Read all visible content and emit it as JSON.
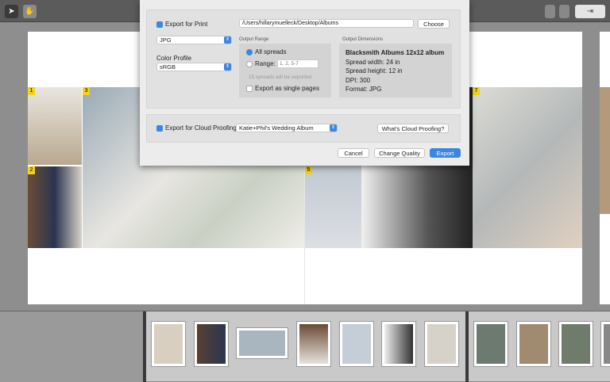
{
  "toolbar": {
    "tools": [
      {
        "icon": "arrow-pointer-icon",
        "glyph": "➤"
      },
      {
        "icon": "hand-icon",
        "glyph": "✋"
      }
    ],
    "right": [
      {
        "icon": "single-page-view-icon"
      },
      {
        "icon": "spread-view-icon"
      },
      {
        "icon": "export-icon",
        "glyph": "⇥"
      }
    ]
  },
  "spread": {
    "pages": [
      "1",
      "2",
      "3",
      "5",
      "7"
    ]
  },
  "dialog": {
    "export_print_label": "Export for Print",
    "path_value": "/Users/hillarymuelleck/Desktop/Albums",
    "choose_label": "Choose",
    "format_value": "JPG",
    "color_profile_label": "Color Profile",
    "color_profile_value": "sRGB",
    "output_range_label": "Output Range",
    "all_spreads_label": "All spreads",
    "range_label": "Range:",
    "range_placeholder": "1, 2, 5-7",
    "spreads_note": "15 spreads will be exported",
    "single_pages_label": "Export as single pages",
    "output_dimensions_label": "Output Dimensions",
    "dims": {
      "album": "Blacksmith Albums 12x12 album",
      "width": "Spread width: 24 in",
      "height": "Spread height: 12 in",
      "dpi": "DPI: 300",
      "format": "Format: JPG"
    },
    "cloud_label": "Export for Cloud Proofing",
    "cloud_album_value": "Katie+Phil's Wedding Album",
    "whats_cloud_label": "What's Cloud Proofing?",
    "cancel_label": "Cancel",
    "change_quality_label": "Change Quality",
    "export_label": "Export",
    "accent": "#3d86e0"
  }
}
